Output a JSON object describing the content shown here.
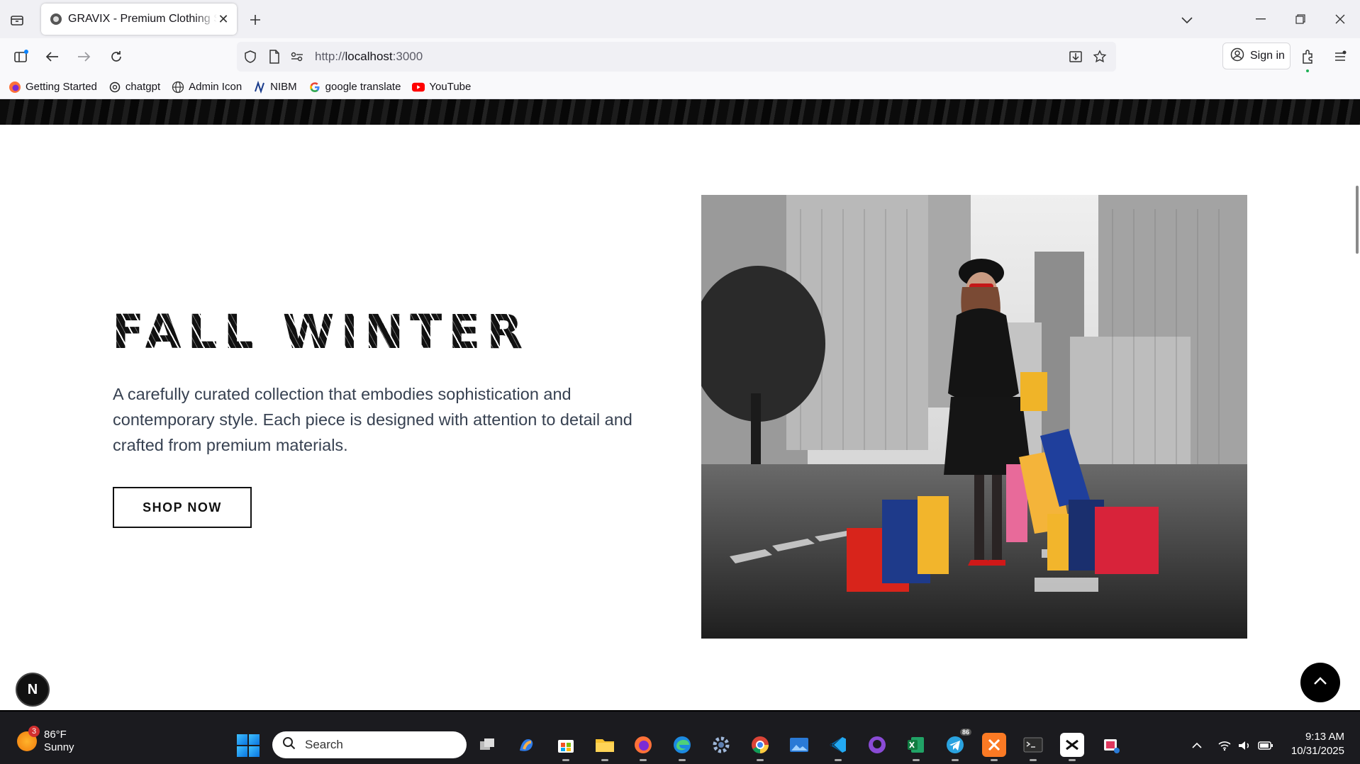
{
  "browser": {
    "tab_title": "GRAVIX - Premium Clothing Store",
    "url_scheme": "http://",
    "url_host": "localhost",
    "url_port": ":3000",
    "signin_label": "Sign in",
    "bookmarks": [
      {
        "label": "Getting Started",
        "icon": "firefox-icon"
      },
      {
        "label": "chatgpt",
        "icon": "chatgpt-icon"
      },
      {
        "label": "Admin Icon",
        "icon": "globe-icon"
      },
      {
        "label": "NIBM",
        "icon": "nibm-icon"
      },
      {
        "label": "google translate",
        "icon": "google-icon"
      },
      {
        "label": "YouTube",
        "icon": "youtube-icon"
      }
    ]
  },
  "hero": {
    "headline": "FALL WINTER",
    "description": "A carefully curated collection that embodies sophistication and contemporary style. Each piece is designed with attention to detail and crafted from premium materials.",
    "cta_label": "SHOP NOW"
  },
  "overlay": {
    "dev_badge": "N"
  },
  "taskbar": {
    "weather_temp": "86°F",
    "weather_desc": "Sunny",
    "weather_badge": "3",
    "search_placeholder": "Search",
    "telegram_badge": "86",
    "time": "9:13 AM",
    "date": "10/31/2025"
  },
  "colors": {
    "accent": "#0a74e0",
    "button_border": "#111111",
    "text_body": "#374151"
  }
}
